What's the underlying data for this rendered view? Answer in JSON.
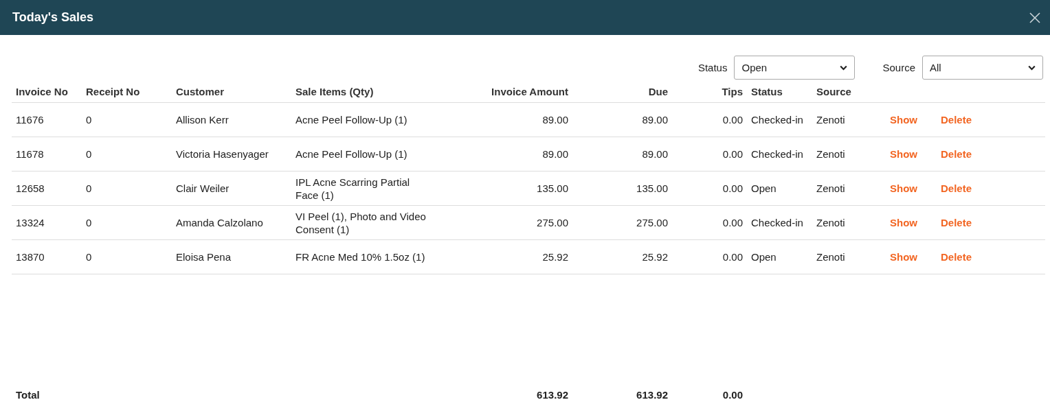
{
  "window": {
    "title": "Today's Sales"
  },
  "filters": [
    {
      "label": "Status",
      "value": "Open"
    },
    {
      "label": "Source",
      "value": "All"
    }
  ],
  "table": {
    "columns": [
      "Invoice No",
      "Receipt No",
      "Customer",
      "Sale Items (Qty)",
      "Invoice Amount",
      "Due",
      "Tips",
      "Status",
      "Source"
    ],
    "rows": [
      {
        "invoice_no": "11676",
        "receipt_no": "0",
        "customer": "Allison Kerr",
        "sale_items": "Acne Peel Follow-Up (1)",
        "invoice_amount": "89.00",
        "due": "89.00",
        "tips": "0.00",
        "status": "Checked-in",
        "source": "Zenoti",
        "actions": [
          "Show",
          "Delete"
        ]
      },
      {
        "invoice_no": "11678",
        "receipt_no": "0",
        "customer": "Victoria Hasenyager",
        "sale_items": "Acne Peel Follow-Up (1)",
        "invoice_amount": "89.00",
        "due": "89.00",
        "tips": "0.00",
        "status": "Checked-in",
        "source": "Zenoti",
        "actions": [
          "Show",
          "Delete"
        ]
      },
      {
        "invoice_no": "12658",
        "receipt_no": "0",
        "customer": "Clair Weiler",
        "sale_items": "IPL Acne Scarring Partial Face (1)",
        "invoice_amount": "135.00",
        "due": "135.00",
        "tips": "0.00",
        "status": "Open",
        "source": "Zenoti",
        "actions": [
          "Show",
          "Delete"
        ]
      },
      {
        "invoice_no": "13324",
        "receipt_no": "0",
        "customer": "Amanda Calzolano",
        "sale_items": "VI Peel (1), Photo and Video Consent (1)",
        "invoice_amount": "275.00",
        "due": "275.00",
        "tips": "0.00",
        "status": "Checked-in",
        "source": "Zenoti",
        "actions": [
          "Show",
          "Delete"
        ]
      },
      {
        "invoice_no": "13870",
        "receipt_no": "0",
        "customer": "Eloisa Pena",
        "sale_items": "FR Acne Med 10% 1.5oz (1)",
        "invoice_amount": "25.92",
        "due": "25.92",
        "tips": "0.00",
        "status": "Open",
        "source": "Zenoti",
        "actions": [
          "Show",
          "Delete"
        ]
      }
    ],
    "total": {
      "label": "Total",
      "invoice_amount": "613.92",
      "due": "613.92",
      "tips": "0.00"
    }
  }
}
